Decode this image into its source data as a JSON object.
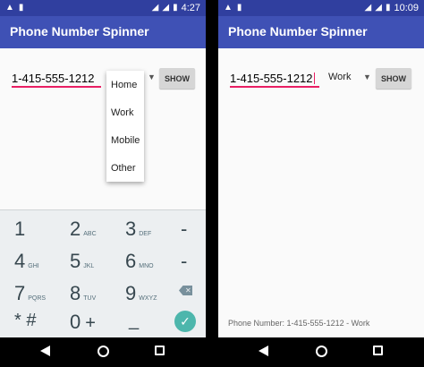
{
  "colors": {
    "status_bar": "#303f9f",
    "app_bar": "#3f51b5",
    "accent": "#e91e63",
    "keypad_bg": "#eceff1",
    "done_key": "#4db6ac"
  },
  "left": {
    "status": {
      "time": "4:27",
      "left_icons": [
        "warning-icon",
        "sim-card-icon"
      ],
      "right_icons": [
        "no-signal-icon",
        "signal-icon",
        "battery-icon"
      ]
    },
    "app_title": "Phone Number Spinner",
    "phone_value": "1-415-555-1212",
    "show_label": "SHOW",
    "dropdown": [
      "Home",
      "Work",
      "Mobile",
      "Other"
    ],
    "keys": [
      {
        "digit": "1",
        "letters": ""
      },
      {
        "digit": "2",
        "letters": "ABC"
      },
      {
        "digit": "3",
        "letters": "DEF"
      },
      {
        "digit": "-",
        "letters": ""
      },
      {
        "digit": "4",
        "letters": "GHI"
      },
      {
        "digit": "5",
        "letters": "JKL"
      },
      {
        "digit": "6",
        "letters": "MNO"
      },
      {
        "digit": "-",
        "letters": ""
      },
      {
        "digit": "7",
        "letters": "PQRS"
      },
      {
        "digit": "8",
        "letters": "TUV"
      },
      {
        "digit": "9",
        "letters": "WXYZ"
      },
      {
        "digit": "0",
        "letters": "+"
      }
    ],
    "star_hash": "* #",
    "space_key": "_"
  },
  "right": {
    "status": {
      "time": "10:09",
      "left_icons": [
        "warning-icon",
        "sim-card-icon"
      ],
      "right_icons": [
        "no-signal-icon",
        "signal-icon",
        "battery-icon"
      ]
    },
    "app_title": "Phone Number Spinner",
    "phone_value": "1-415-555-1212",
    "spinner_value": "Work",
    "show_label": "SHOW",
    "result": "Phone Number: 1-415-555-1212 - Work"
  }
}
